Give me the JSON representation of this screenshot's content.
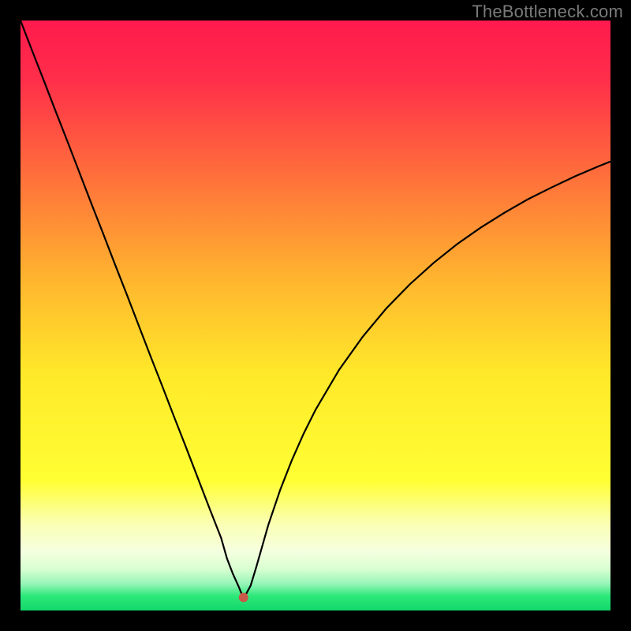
{
  "watermark": "TheBottleneck.com",
  "chart_data": {
    "type": "line",
    "title": "",
    "xlabel": "",
    "ylabel": "",
    "xlim": [
      0,
      100
    ],
    "ylim": [
      0,
      100
    ],
    "background_gradient": {
      "stops": [
        {
          "pos": 0.0,
          "color": "#ff1a4d"
        },
        {
          "pos": 0.1,
          "color": "#ff2e4a"
        },
        {
          "pos": 0.25,
          "color": "#ff6a3c"
        },
        {
          "pos": 0.45,
          "color": "#ffb92e"
        },
        {
          "pos": 0.6,
          "color": "#ffe92a"
        },
        {
          "pos": 0.78,
          "color": "#ffff33"
        },
        {
          "pos": 0.85,
          "color": "#fbffb0"
        },
        {
          "pos": 0.9,
          "color": "#f5ffe0"
        },
        {
          "pos": 0.93,
          "color": "#d8ffd0"
        },
        {
          "pos": 0.955,
          "color": "#96f5b8"
        },
        {
          "pos": 0.975,
          "color": "#2ee87a"
        },
        {
          "pos": 1.0,
          "color": "#12d86a"
        }
      ]
    },
    "curve_color": "#000000",
    "curve_width": 2.2,
    "marker": {
      "x": 37.8,
      "y": 97.8,
      "font": "•",
      "color": "#c95a4a"
    },
    "x": [
      0,
      2,
      4,
      6,
      8,
      10,
      12,
      14,
      16,
      18,
      20,
      22,
      24,
      26,
      28,
      30,
      32,
      34,
      35,
      36,
      37,
      37.8,
      39,
      40,
      42,
      44,
      46,
      48,
      50,
      54,
      58,
      62,
      66,
      70,
      74,
      78,
      82,
      86,
      90,
      94,
      98,
      100
    ],
    "y": [
      0,
      5.2,
      10.3,
      15.5,
      20.6,
      25.8,
      31.0,
      36.1,
      41.3,
      46.4,
      51.6,
      56.8,
      61.9,
      67.1,
      72.2,
      77.4,
      82.6,
      87.7,
      91.2,
      93.8,
      96.0,
      98.0,
      95.8,
      92.5,
      85.5,
      79.6,
      74.5,
      70.0,
      66.0,
      59.2,
      53.6,
      48.8,
      44.7,
      41.1,
      37.9,
      35.1,
      32.6,
      30.3,
      28.3,
      26.4,
      24.7,
      23.9
    ]
  }
}
